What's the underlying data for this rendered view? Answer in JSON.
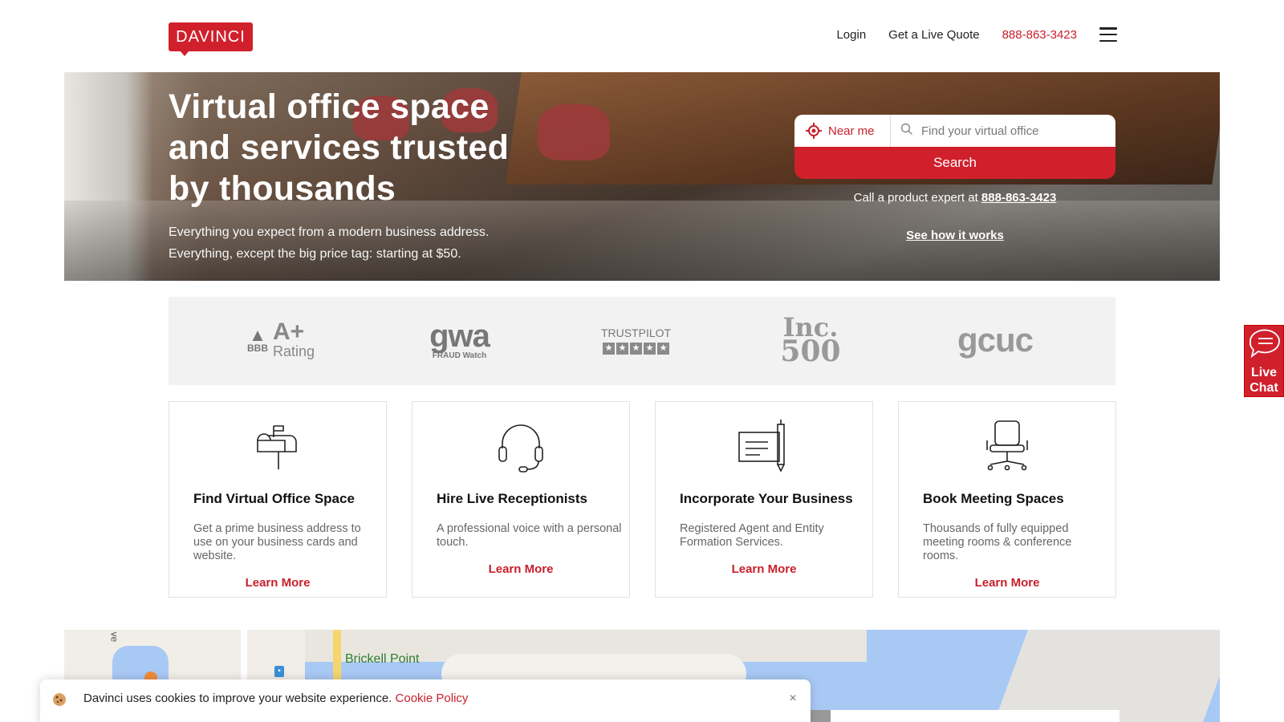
{
  "brand": {
    "logo_text": "DAVINCI",
    "accent": "#d0202c"
  },
  "nav": {
    "login": "Login",
    "quote": "Get a Live Quote",
    "phone": "888-863-3423",
    "menu_icon": "hamburger-icon"
  },
  "hero": {
    "title": "Virtual office space and services trusted by thousands",
    "subtitle_line1": "Everything you expect from a modern business address.",
    "subtitle_line2": "Everything, except the big price tag: starting at $50."
  },
  "search": {
    "near_me": "Near me",
    "placeholder": "Find your virtual office",
    "button": "Search",
    "call_prefix": "Call a product expert at",
    "call_phone": "888-863-3423",
    "how_it_works": "See how it works"
  },
  "trust": {
    "bbb_top": "BBB",
    "bbb_grade": "A+",
    "bbb_rating": "Rating",
    "gwa_main": "gwa",
    "gwa_sub": "FRAUD Watch",
    "trustpilot": "TRUSTPILOT",
    "inc_top": "Inc.",
    "inc_bottom": "500",
    "gcuc": "gcuc"
  },
  "cards": [
    {
      "title": "Find Virtual Office Space",
      "desc": "Get a prime business address to use on your business cards and website.",
      "link": "Learn More",
      "icon": "mailbox-icon"
    },
    {
      "title": "Hire Live Receptionists",
      "desc": "A professional voice with a personal touch.",
      "link": "Learn More",
      "icon": "headset-icon"
    },
    {
      "title": "Incorporate Your Business",
      "desc": "Registered Agent and Entity Formation Services.",
      "link": "Learn More",
      "icon": "document-pen-icon"
    },
    {
      "title": "Book Meeting Spaces",
      "desc": "Thousands of fully equipped meeting rooms & conference rooms.",
      "link": "Learn More",
      "icon": "office-chair-icon"
    }
  ],
  "map": {
    "label": "Brickell Point",
    "street_fragment": "ve"
  },
  "cookie": {
    "text": "Davinci uses cookies to improve your website experience.",
    "link": "Cookie Policy",
    "close": "×"
  },
  "chat": {
    "line1": "Live",
    "line2": "Chat"
  }
}
